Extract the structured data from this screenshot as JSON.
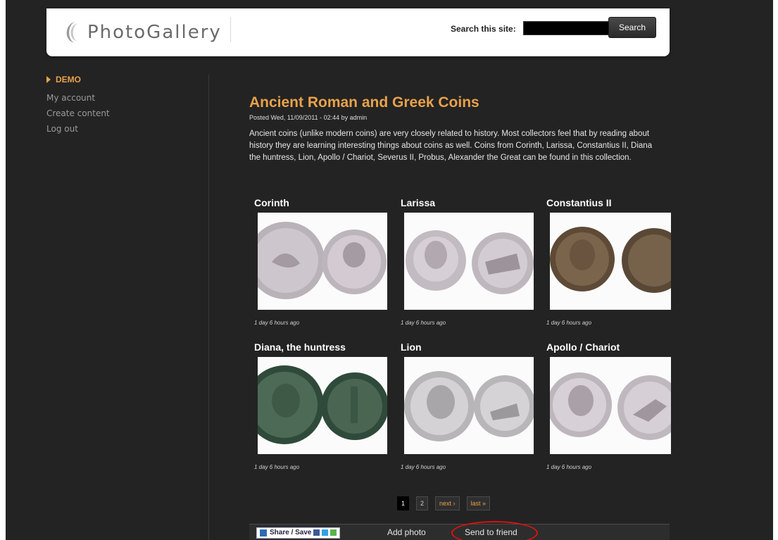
{
  "header": {
    "logo_text": "PhotoGallery",
    "search_label": "Search this site:",
    "search_value": "",
    "search_button": "Search"
  },
  "sidebar": {
    "heading": "DEMO",
    "links": [
      "My account",
      "Create content",
      "Log out"
    ]
  },
  "article": {
    "title": "Ancient Roman and Greek Coins",
    "meta": "Posted Wed, 11/09/2011 - 02:44 by admin",
    "intro": "Ancient coins (unlike modern coins) are very closely related to history. Most collectors feel that by reading about history they are learning interesting things about coins as well. Coins from Corinth, Larissa, Constantius II, Diana the huntress, Lion, Apollo / Chariot, Severus II, Probus, Alexander the Great can be found in this collection."
  },
  "gallery": [
    {
      "title": "Corinth",
      "time": "1 day 6 hours ago"
    },
    {
      "title": "Larissa",
      "time": "1 day 6 hours ago"
    },
    {
      "title": "Constantius II",
      "time": "1 day 6 hours ago"
    },
    {
      "title": "Diana, the huntress",
      "time": "1 day 6 hours ago"
    },
    {
      "title": "Lion",
      "time": "1 day 6 hours ago"
    },
    {
      "title": "Apollo / Chariot",
      "time": "1 day 6 hours ago"
    }
  ],
  "pager": {
    "current": "1",
    "page2": "2",
    "next": "next ›",
    "last": "last »"
  },
  "actions": {
    "share": "Share / Save",
    "add_photo": "Add photo",
    "send_to_friend": "Send to friend"
  },
  "colors": {
    "accent": "#e8a24a",
    "background": "#232323",
    "highlight_circle": "#dd1111"
  }
}
